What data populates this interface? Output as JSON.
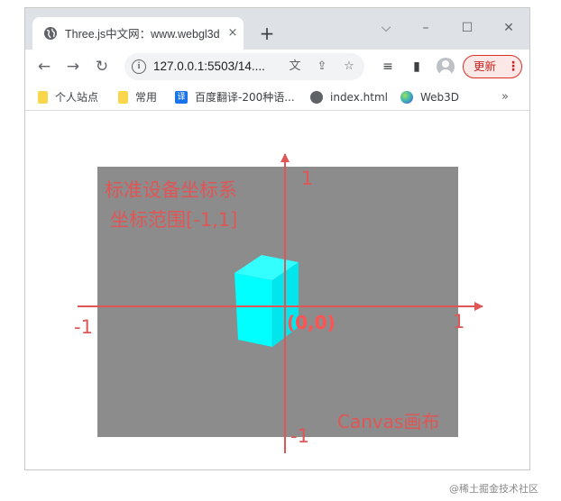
{
  "browser": {
    "tab_title": "Three.js中文网：www.webgl3d",
    "tab_close": "×",
    "new_tab": "+",
    "url": "127.0.0.1:5503/14....",
    "update_label": "更新",
    "update_menu": "⋮",
    "window_controls": {
      "dropdown": "⌵",
      "minimize": "–",
      "maximize": "☐",
      "close": "✕"
    },
    "nav": {
      "back": "←",
      "forward": "→",
      "reload": "↻"
    },
    "omnibox_icons": {
      "info": "i",
      "translate": "⽂",
      "share": "⇪",
      "star": "☆"
    },
    "toolbar_icons": {
      "reading_list": "≡",
      "side_panel": "▮"
    }
  },
  "bookmarks": {
    "items": [
      {
        "label": "个人站点",
        "icon": "folder-icon"
      },
      {
        "label": "常用",
        "icon": "folder-icon"
      },
      {
        "label": "百度翻译-200种语...",
        "icon": "translate-icon",
        "icon_glyph": "译"
      },
      {
        "label": "index.html",
        "icon": "globe-icon"
      },
      {
        "label": "Web3D",
        "icon": "web3d-icon"
      }
    ],
    "more": "»"
  },
  "diagram": {
    "title_line1": "标准设备坐标系",
    "title_line2": "坐标范围[-1,1]",
    "label_y_top": "1",
    "label_y_bottom": "-1",
    "label_x_left": "-1",
    "label_x_right": "1",
    "origin_label": "(0,0)",
    "canvas_label": "Canvas画布",
    "colors": {
      "canvas": "#8c8c8c",
      "axis": "#e05555",
      "text": "#e05555",
      "cube_front": "#00ffff",
      "cube_top": "#33ffff",
      "cube_side": "#00e0e6",
      "origin_text": "#ff5252"
    }
  },
  "watermark": "@稀土掘金技术社区"
}
